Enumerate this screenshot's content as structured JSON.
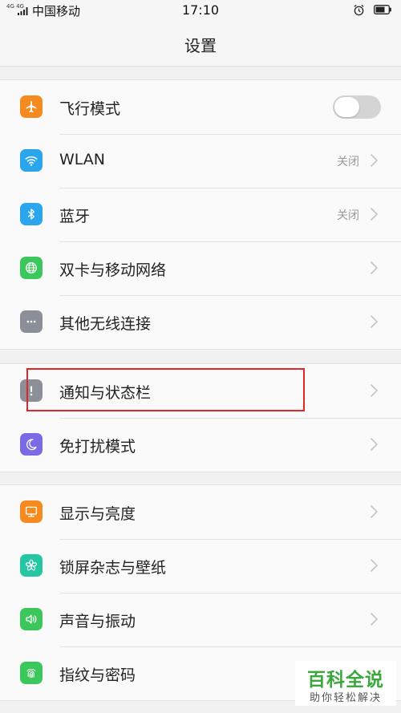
{
  "status_bar": {
    "network": "4G 4G",
    "carrier": "中国移动",
    "time": "17:10"
  },
  "header": {
    "title": "设置"
  },
  "groups": [
    {
      "items": [
        {
          "label": "飞行模式",
          "icon": "airplane-icon",
          "icon_color": "#f58b1f",
          "control": "toggle",
          "toggle_on": false
        },
        {
          "label": "WLAN",
          "icon": "wifi-icon",
          "icon_color": "#29a6ee",
          "value": "关闭"
        },
        {
          "label": "蓝牙",
          "icon": "bluetooth-icon",
          "icon_color": "#29a6ee",
          "value": "关闭"
        },
        {
          "label": "双卡与移动网络",
          "icon": "globe-icon",
          "icon_color": "#3bc75c"
        },
        {
          "label": "其他无线连接",
          "icon": "more-icon",
          "icon_color": "#8a8f98"
        }
      ]
    },
    {
      "items": [
        {
          "label": "通知与状态栏",
          "icon": "exclamation-icon",
          "icon_color": "#8a8f98"
        },
        {
          "label": "免打扰模式",
          "icon": "moon-icon",
          "icon_color": "#7a6ae6"
        }
      ]
    },
    {
      "items": [
        {
          "label": "显示与亮度",
          "icon": "monitor-icon",
          "icon_color": "#f58b1f"
        },
        {
          "label": "锁屏杂志与壁纸",
          "icon": "flower-icon",
          "icon_color": "#25c7a3"
        },
        {
          "label": "声音与振动",
          "icon": "speaker-icon",
          "icon_color": "#3bc75c"
        },
        {
          "label": "指纹与密码",
          "icon": "fingerprint-icon",
          "icon_color": "#3bc75c"
        }
      ]
    }
  ],
  "watermark": {
    "main": "百科全说",
    "sub": "助你轻松解决"
  },
  "colors": {
    "highlight": "#e0262b",
    "watermark": "#3aa83c"
  }
}
